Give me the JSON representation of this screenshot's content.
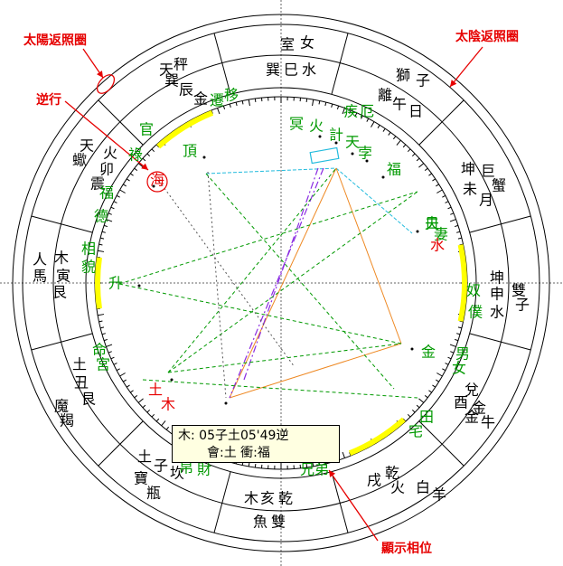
{
  "annotations": {
    "solar_return": "太陽返照圈",
    "lunar_return": "太陰返照圈",
    "retrograde": "逆行",
    "show_aspects": "顯示相位"
  },
  "tooltip": {
    "line1": "木: 05子土05'49逆",
    "line2": "會:土 衝:福"
  },
  "colors": {
    "red": "#e60000",
    "green": "#009900",
    "yellow": "#ffff00",
    "cyan": "#22bbdd",
    "purple": "#8a2be2",
    "orange": "#ee8822",
    "black": "#000000",
    "tooltip_bg": "#ffffe1"
  },
  "wheel": {
    "outer_texts": [
      {
        "text": "室女",
        "color": "black"
      },
      {
        "text": "獅子",
        "color": "black"
      },
      {
        "text": "巨蟹",
        "color": "black"
      },
      {
        "text": "雙子",
        "color": "black"
      },
      {
        "text": "金牛",
        "color": "black"
      },
      {
        "text": "白羊",
        "color": "black"
      },
      {
        "text": "魚雙",
        "color": "black"
      },
      {
        "text": "寶瓶",
        "color": "black"
      },
      {
        "text": "魔羯",
        "color": "black"
      },
      {
        "text": "人馬",
        "color": "black"
      },
      {
        "text": "天蠍",
        "color": "black"
      },
      {
        "text": "天秤",
        "color": "black"
      }
    ],
    "mid_texts": [
      {
        "text": "巽巳水",
        "color": "black"
      },
      {
        "text": "離午日",
        "color": "black"
      },
      {
        "text": "坤未月",
        "color": "black"
      },
      {
        "text": "坤申水",
        "color": "black"
      },
      {
        "text": "兌酉金",
        "color": "black"
      },
      {
        "text": "乾戌火",
        "color": "black"
      },
      {
        "text": "木亥乾",
        "color": "black"
      },
      {
        "text": "土子坎",
        "color": "black"
      },
      {
        "text": "土丑艮",
        "color": "black"
      },
      {
        "text": "木寅艮",
        "color": "black"
      },
      {
        "text": "火卯震",
        "color": "black"
      },
      {
        "text": "巽辰金",
        "color": "black"
      }
    ],
    "house_texts": [
      {
        "text": "遷移",
        "color": "green"
      },
      {
        "text": "疾厄",
        "color": "green"
      },
      {
        "text": "夫妻",
        "color": "green"
      },
      {
        "text": "奴僕",
        "color": "green"
      },
      {
        "text": "男女",
        "color": "green"
      },
      {
        "text": "田宅",
        "color": "green"
      },
      {
        "text": "兄弟",
        "color": "green"
      },
      {
        "text": "財帛",
        "color": "green"
      },
      {
        "text": "命宮",
        "color": "green"
      },
      {
        "text": "相貌",
        "color": "green"
      },
      {
        "text": "福德",
        "color": "green"
      },
      {
        "text": "官祿",
        "color": "green"
      }
    ],
    "planets": [
      {
        "text": "冥",
        "color": "green"
      },
      {
        "text": "火",
        "color": "green"
      },
      {
        "text": "計",
        "color": "green"
      },
      {
        "text": "天",
        "color": "green"
      },
      {
        "text": "孛",
        "color": "green"
      },
      {
        "text": "福",
        "color": "green"
      },
      {
        "text": "日",
        "color": "green"
      },
      {
        "text": "水",
        "color": "red"
      },
      {
        "text": "金",
        "color": "green"
      },
      {
        "text": "土",
        "color": "red"
      },
      {
        "text": "木",
        "color": "red"
      },
      {
        "text": "升",
        "color": "green"
      },
      {
        "text": "頂",
        "color": "green"
      },
      {
        "text": "海",
        "color": "red"
      }
    ]
  }
}
